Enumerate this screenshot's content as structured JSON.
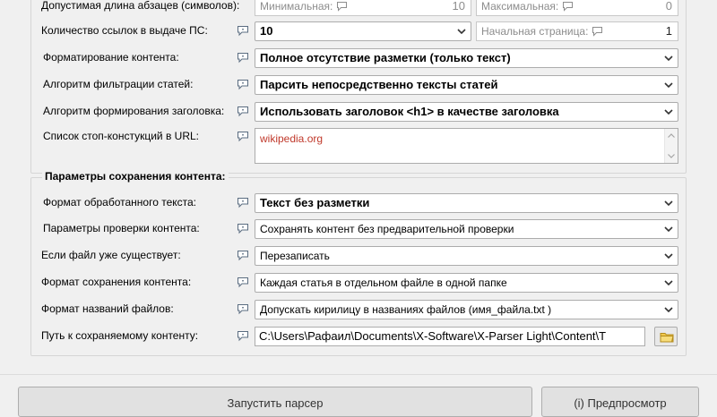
{
  "content_settings": {
    "paragraph_length": {
      "label": "Допустимая длина абзацев (символов):",
      "min_placeholder": "Минимальная:",
      "min_value": "10",
      "max_placeholder": "Максимальная:",
      "max_value": "0"
    },
    "links_count": {
      "label": "Количество ссылок в выдаче ПС:",
      "value": "10",
      "start_page_placeholder": "Начальная страница:",
      "start_page_value": "1"
    },
    "formatting": {
      "label": "Форматирование контента:",
      "value": "Полное отсутствие разметки (только текст)"
    },
    "filter_algorithm": {
      "label": "Алгоритм фильтрации статей:",
      "value": "Парсить непосредственно тексты статей"
    },
    "title_algorithm": {
      "label": "Алгоритм формирования заголовка:",
      "value": "Использовать заголовок <h1> в качестве заголовка"
    },
    "stop_constructs": {
      "label": "Список стоп-констукций в URL:",
      "value": "wikipedia.org"
    }
  },
  "save_settings": {
    "title": "Параметры сохранения контента:",
    "text_format": {
      "label": "Формат обработанного текста:",
      "value": "Текст без разметки"
    },
    "check_params": {
      "label": "Параметры проверки контента:",
      "value": "Сохранять контент без предварительной проверки"
    },
    "file_exists": {
      "label": "Если файл уже существует:",
      "value": "Перезаписать"
    },
    "save_format": {
      "label": "Формат сохранения контента:",
      "value": "Каждая статья в отдельном файле в одной папке"
    },
    "filename_format": {
      "label": "Формат названий файлов:",
      "value": "Допускать кирилицу в названиях файлов (имя_файла.txt )"
    },
    "content_path": {
      "label": "Путь к сохраняемому контенту:",
      "value": "C:\\Users\\Рафаил\\Documents\\X-Software\\X-Parser Light\\Content\\T"
    }
  },
  "buttons": {
    "start_label": "Запустить парсер",
    "preview_label": "(i) Предпросмотр"
  },
  "colors": {
    "background": "#f0f0f0",
    "stop_list_text": "#c0392b",
    "placeholder": "#8d8d8d"
  },
  "icons": {
    "help": "speech-bubble-icon",
    "dropdown": "chevron-down-icon",
    "folder": "folder-icon"
  }
}
